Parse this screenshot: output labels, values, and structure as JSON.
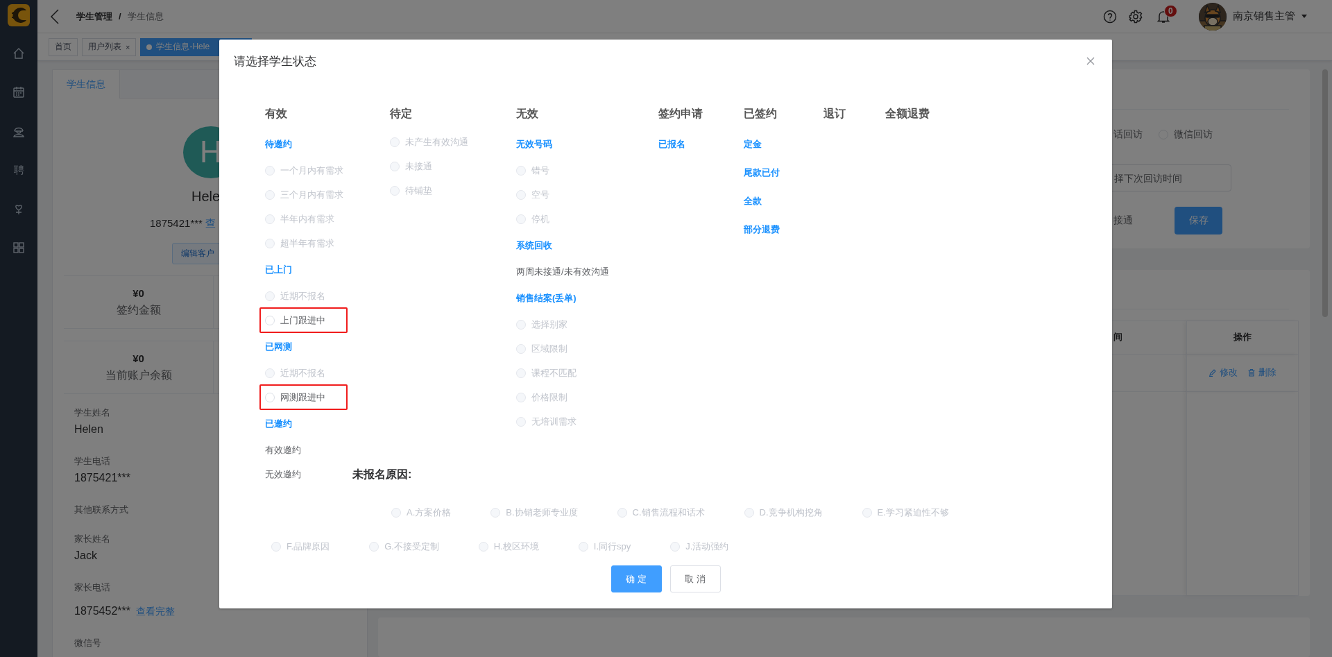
{
  "sidebar": {
    "items": [
      {
        "kind": "home"
      },
      {
        "kind": "calendar"
      },
      {
        "kind": "person"
      },
      {
        "kind": "glyph",
        "text": "聘"
      },
      {
        "kind": "heart"
      },
      {
        "kind": "grid"
      }
    ]
  },
  "header": {
    "breadcrumb": [
      "学生管理",
      "学生信息"
    ],
    "separator": "/",
    "notification_count": "0",
    "user_name": "南京销售主管"
  },
  "tags": [
    {
      "label": "首页",
      "selected": false
    },
    {
      "label": "用户列表",
      "close": "×",
      "selected": false
    },
    {
      "label": "学生信息-Hele",
      "selected": true
    }
  ],
  "student_card": {
    "tab": "学生信息",
    "avatar_letter": "H",
    "name": "Hele",
    "phone": "1875421***",
    "phone_link": "查",
    "edit_button": "编辑客户",
    "stats": [
      {
        "value": "¥0",
        "label": "签约金额"
      },
      {
        "value": "¥0",
        "label": "当前账户余额"
      }
    ],
    "fields": [
      {
        "label": "学生姓名",
        "value": "Helen"
      },
      {
        "label": "学生电话",
        "value": "1875421***"
      },
      {
        "label": "其他联系方式"
      },
      {
        "label": "家长姓名",
        "value": "Jack"
      },
      {
        "label": "家长电话",
        "value": "1875452***",
        "link": "查看完整"
      },
      {
        "label": "微信号"
      }
    ]
  },
  "followup_card": {
    "options": [
      {
        "kind": "label",
        "label": "话回访"
      },
      {
        "kind": "radio",
        "label": "微信回访",
        "selected": false
      }
    ],
    "date_placeholder": "择下次回访时间",
    "status_text": "接通",
    "save_button": "保存"
  },
  "records_card": {
    "columns": [
      "间",
      "操作"
    ],
    "rows": [
      {
        "actions": [
          {
            "kind": "edit",
            "label": "修改"
          },
          {
            "kind": "delete",
            "label": "删除"
          }
        ]
      }
    ]
  },
  "dialog": {
    "title": "请选择学生状态",
    "columns": [
      {
        "heading": "有效",
        "items": [
          {
            "kind": "group",
            "label": "待邀约"
          },
          {
            "kind": "radio",
            "label": "一个月内有需求",
            "disabled": true,
            "selected": false,
            "highlighted": false
          },
          {
            "kind": "radio",
            "label": "三个月内有需求",
            "disabled": true,
            "selected": false,
            "highlighted": false
          },
          {
            "kind": "radio",
            "label": "半年内有需求",
            "disabled": true,
            "selected": false,
            "highlighted": false
          },
          {
            "kind": "radio",
            "label": "超半年有需求",
            "disabled": true,
            "selected": false,
            "highlighted": false
          },
          {
            "kind": "group",
            "label": "已上门"
          },
          {
            "kind": "radio",
            "label": "近期不报名",
            "disabled": true,
            "selected": false,
            "highlighted": false
          },
          {
            "kind": "radio",
            "label": "上门跟进中",
            "disabled": false,
            "selected": false,
            "highlighted": true
          },
          {
            "kind": "group",
            "label": "已网测"
          },
          {
            "kind": "radio",
            "label": "近期不报名",
            "disabled": true,
            "selected": false,
            "highlighted": false
          },
          {
            "kind": "radio",
            "label": "网测跟进中",
            "disabled": false,
            "selected": false,
            "highlighted": true
          },
          {
            "kind": "group",
            "label": "已邀约"
          },
          {
            "kind": "text",
            "label": "有效邀约"
          },
          {
            "kind": "text",
            "label": "无效邀约"
          }
        ]
      },
      {
        "heading": "待定",
        "items": [
          {
            "kind": "radio",
            "label": "未产生有效沟通",
            "disabled": true,
            "selected": false,
            "highlighted": false
          },
          {
            "kind": "radio",
            "label": "未接通",
            "disabled": true,
            "selected": false,
            "highlighted": false
          },
          {
            "kind": "radio",
            "label": "待铺垫",
            "disabled": true,
            "selected": false,
            "highlighted": false
          }
        ]
      },
      {
        "heading": "无效",
        "items": [
          {
            "kind": "group",
            "label": "无效号码"
          },
          {
            "kind": "radio",
            "label": "错号",
            "disabled": true,
            "selected": false,
            "highlighted": false
          },
          {
            "kind": "radio",
            "label": "空号",
            "disabled": true,
            "selected": false,
            "highlighted": false
          },
          {
            "kind": "radio",
            "label": "停机",
            "disabled": true,
            "selected": false,
            "highlighted": false
          },
          {
            "kind": "group",
            "label": "系统回收"
          },
          {
            "kind": "text",
            "label": "两周未接通/未有效沟通"
          },
          {
            "kind": "group",
            "label": "销售结案(丢单)"
          },
          {
            "kind": "radio",
            "label": "选择别家",
            "disabled": true,
            "selected": false,
            "highlighted": false
          },
          {
            "kind": "radio",
            "label": "区域限制",
            "disabled": true,
            "selected": false,
            "highlighted": false
          },
          {
            "kind": "radio",
            "label": "课程不匹配",
            "disabled": true,
            "selected": false,
            "highlighted": false
          },
          {
            "kind": "radio",
            "label": "价格限制",
            "disabled": true,
            "selected": false,
            "highlighted": false
          },
          {
            "kind": "radio",
            "label": "无培训需求",
            "disabled": true,
            "selected": false,
            "highlighted": false
          }
        ]
      },
      {
        "heading": "签约申请",
        "items": [
          {
            "kind": "group",
            "label": "已报名"
          }
        ]
      },
      {
        "heading": "已签约",
        "items": [
          {
            "kind": "group",
            "label": "定金"
          },
          {
            "kind": "group",
            "label": "尾款已付"
          },
          {
            "kind": "group",
            "label": "全款"
          },
          {
            "kind": "group",
            "label": "部分退费"
          }
        ]
      },
      {
        "heading": "退订"
      },
      {
        "heading": "全额退费"
      }
    ],
    "reasons": {
      "title": "未报名原因:",
      "rows": [
        {
          "options": [
            {
              "label": "A.方案价格",
              "disabled": true,
              "selected": false
            },
            {
              "label": "B.协销老师专业度",
              "disabled": true,
              "selected": false
            },
            {
              "label": "C.销售流程和话术",
              "disabled": true,
              "selected": false
            },
            {
              "label": "D.竞争机构挖角",
              "disabled": true,
              "selected": false
            },
            {
              "label": "E.学习紧迫性不够",
              "disabled": true,
              "selected": false
            }
          ]
        },
        {
          "options": [
            {
              "label": "F.品牌原因",
              "disabled": true,
              "selected": false
            },
            {
              "label": "G.不接受定制",
              "disabled": true,
              "selected": false
            },
            {
              "label": "H.校区环境",
              "disabled": true,
              "selected": false
            },
            {
              "label": "I.同行spy",
              "disabled": true,
              "selected": false
            },
            {
              "label": "J.活动强约",
              "disabled": true,
              "selected": false
            }
          ]
        }
      ]
    },
    "buttons": [
      {
        "kind": "primary",
        "label": "确 定"
      },
      {
        "kind": "default",
        "label": "取 消"
      }
    ]
  }
}
